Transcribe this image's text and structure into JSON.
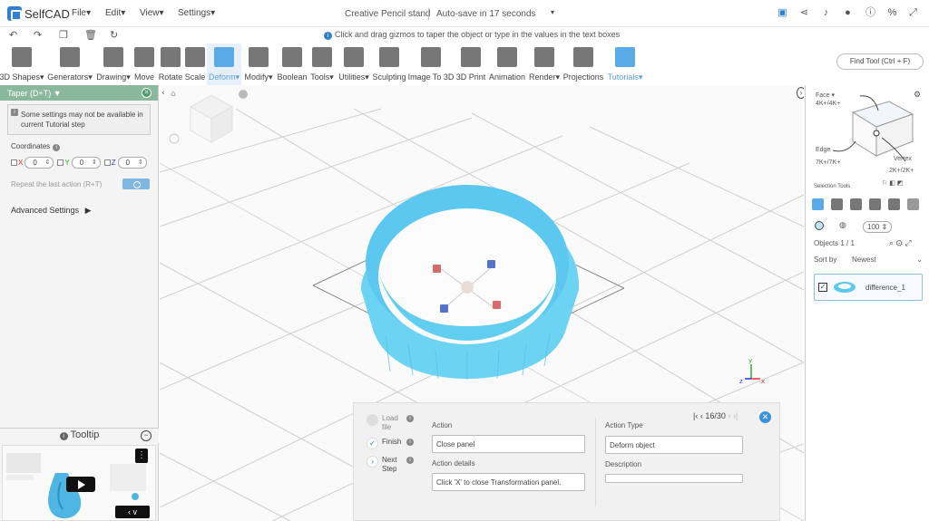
{
  "app": {
    "logo_text": "SelfCAD"
  },
  "menu": [
    {
      "label": "File"
    },
    {
      "label": "Edit"
    },
    {
      "label": "View"
    },
    {
      "label": "Settings"
    }
  ],
  "document": {
    "title": "Creative Pencil stand",
    "autosave": "Auto-save in 17 seconds"
  },
  "hint": {
    "text": "Click and drag gizmos to taper the object or type in the values in the text boxes"
  },
  "toolbar": {
    "tools": [
      {
        "label": "3D Shapes"
      },
      {
        "label": "Generators"
      },
      {
        "label": "Drawing"
      },
      {
        "label": "Move"
      },
      {
        "label": "Rotate"
      },
      {
        "label": "Scale"
      },
      {
        "label": "Deform"
      },
      {
        "label": "Modify"
      },
      {
        "label": "Boolean"
      },
      {
        "label": "Tools"
      },
      {
        "label": "Utilities"
      },
      {
        "label": "Sculpting"
      },
      {
        "label": "Image To 3D"
      },
      {
        "label": "3D Print"
      },
      {
        "label": "Animation"
      },
      {
        "label": "Render"
      },
      {
        "label": "Projections"
      },
      {
        "label": "Tutorials"
      }
    ],
    "find_tool": "Find Tool (Ctrl + F)"
  },
  "left_panel": {
    "title": "Taper (D+T)",
    "warning": "Some settings may not be available in current Tutorial step",
    "coordinates_label": "Coordinates",
    "x_label": "X",
    "x_value": "0",
    "y_label": "Y",
    "y_value": "0",
    "z_label": "Z",
    "z_value": "0",
    "repeat_label": "Repeat the last action (R+T)",
    "advanced_label": "Advanced Settings",
    "tooltip_label": "Tooltip"
  },
  "right_panel": {
    "face_label": "Face",
    "face_shortcut": "4K+/4K+",
    "edge_label": "Edge",
    "edge_shortcut": "7K+/7K+",
    "vertex_label": "Vertex",
    "vertex_shortcut": "2K+/2K+",
    "selection_tools_label": "Selection Tools",
    "size_value": "100",
    "objects_count": "Objects 1 / 1",
    "sort_label": "Sort by",
    "sort_value": "Newest",
    "object_name": "difference_1"
  },
  "tutorial": {
    "steps": [
      {
        "label": "Load file"
      },
      {
        "label": "Finish"
      },
      {
        "label": "Next Step"
      }
    ],
    "action_label": "Action",
    "action_value": "Close panel",
    "action_details_label": "Action details",
    "action_details_value": "Click 'X' to close Transformation panel.",
    "action_type_label": "Action Type",
    "action_type_value": "Deform object",
    "description_label": "Description",
    "description_value": "",
    "pager": "16/30"
  },
  "colors": {
    "accent": "#2f7fd3",
    "object": "#6dd3f3",
    "panel_header": "#8ab89c",
    "toolbar_active": "#5aaae8"
  }
}
